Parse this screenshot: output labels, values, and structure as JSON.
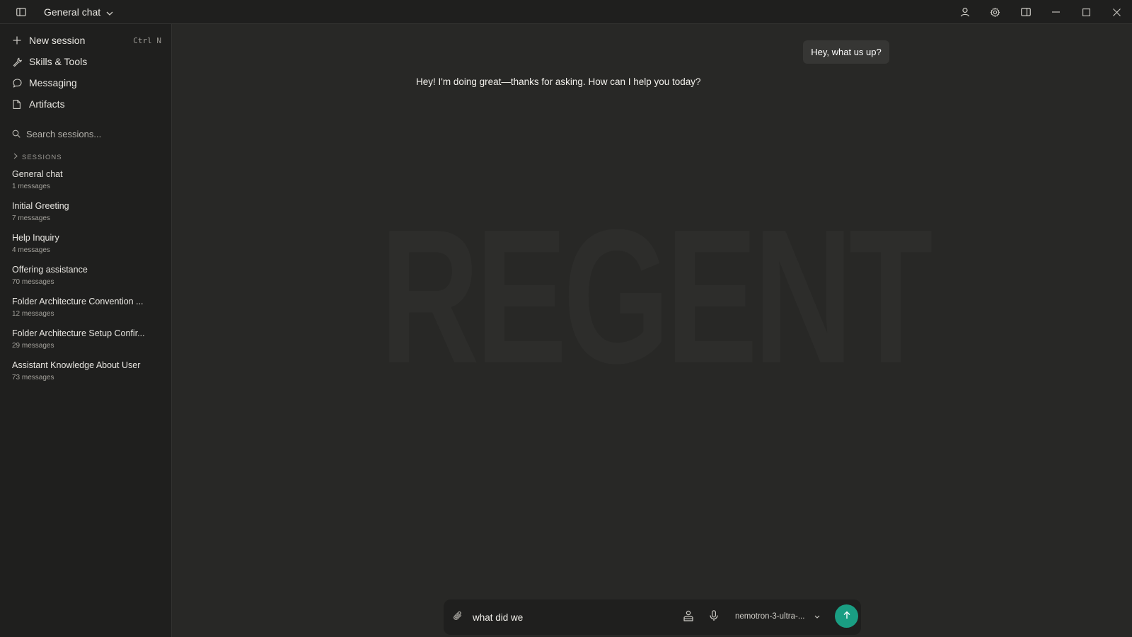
{
  "titlebar": {
    "session_title": "General chat",
    "icons": [
      "sidebar-toggle-icon",
      "chevron-down-icon",
      "user-icon",
      "gear-icon",
      "panel-icon",
      "minimize-icon",
      "maximize-icon",
      "close-icon"
    ]
  },
  "sidebar": {
    "nav": [
      {
        "label": "New session",
        "shortcut": "Ctrl N",
        "icon": "plus-icon"
      },
      {
        "label": "Skills & Tools",
        "icon": "wrench-icon"
      },
      {
        "label": "Messaging",
        "icon": "message-icon"
      },
      {
        "label": "Artifacts",
        "icon": "document-icon"
      }
    ],
    "search_placeholder": "Search sessions...",
    "sessions_header": "SESSIONS",
    "sessions": [
      {
        "title": "General chat",
        "count": "1 messages"
      },
      {
        "title": "Initial Greeting",
        "count": "7 messages"
      },
      {
        "title": "Help Inquiry",
        "count": "4 messages"
      },
      {
        "title": "Offering assistance",
        "count": "70 messages"
      },
      {
        "title": "Folder Architecture Convention ...",
        "count": "12 messages"
      },
      {
        "title": "Folder Architecture Setup Confir...",
        "count": "29 messages"
      },
      {
        "title": "Assistant Knowledge About User",
        "count": "73 messages"
      }
    ]
  },
  "chat": {
    "watermark": "REGENT",
    "user_message": "Hey, what us up?",
    "assistant_message": "Hey! I'm doing great—thanks for asking. How can I help you today?"
  },
  "composer": {
    "input_value": "what did we",
    "model": "nemotron-3-ultra-...",
    "accent_color": "#1a9e83"
  }
}
